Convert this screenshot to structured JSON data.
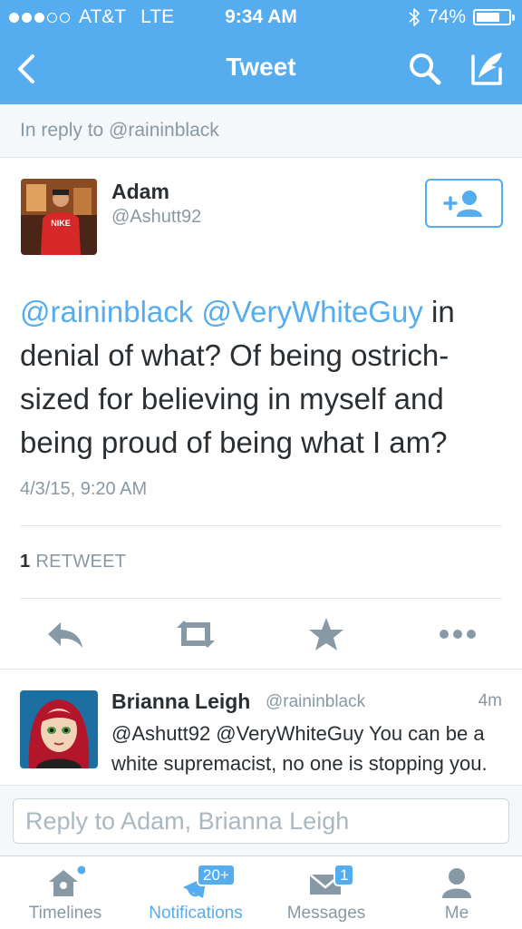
{
  "status_bar": {
    "carrier": "AT&T",
    "network": "LTE",
    "time": "9:34 AM",
    "battery": "74%",
    "battery_level": 0.74,
    "signal_bars": 3,
    "signal_max": 5
  },
  "nav": {
    "title": "Tweet",
    "back_icon": "back-chevron-icon",
    "search_icon": "search-icon",
    "compose_icon": "compose-quill-icon"
  },
  "reply_context": "In reply to @raininblack",
  "tweet": {
    "author_name": "Adam",
    "author_handle": "@Ashutt92",
    "avatar_text": "NIKE",
    "mention_1": "@raininblack",
    "mention_2": "@VeryWhiteGuy",
    "body": "in denial of what? Of being ostrich-sized for believing in myself and being proud of being what I am?",
    "timestamp": "4/3/15, 9:20 AM",
    "retweet_count": "1",
    "retweet_label": "RETWEET"
  },
  "actions": [
    "reply-icon",
    "retweet-icon",
    "favorite-star-icon",
    "more-dots-icon"
  ],
  "reply": {
    "author_name": "Brianna Leigh",
    "author_handle": "@raininblack",
    "time_ago": "4m",
    "text": "@Ashutt92 @VeryWhiteGuy You can be a white supremacist, no one is stopping you. Go make friends on"
  },
  "compose": {
    "placeholder": "Reply to Adam, Brianna Leigh"
  },
  "tabs": [
    {
      "label": "Timelines",
      "icon": "home-icon"
    },
    {
      "label": "Notifications",
      "icon": "notifications-icon",
      "badge": "20+"
    },
    {
      "label": "Messages",
      "icon": "messages-icon",
      "badge": "1"
    },
    {
      "label": "Me",
      "icon": "profile-icon"
    }
  ],
  "colors": {
    "brand_blue": "#55acee",
    "text_dark": "#292f33",
    "text_gray": "#8899a6",
    "divider": "#e1e8ed"
  }
}
